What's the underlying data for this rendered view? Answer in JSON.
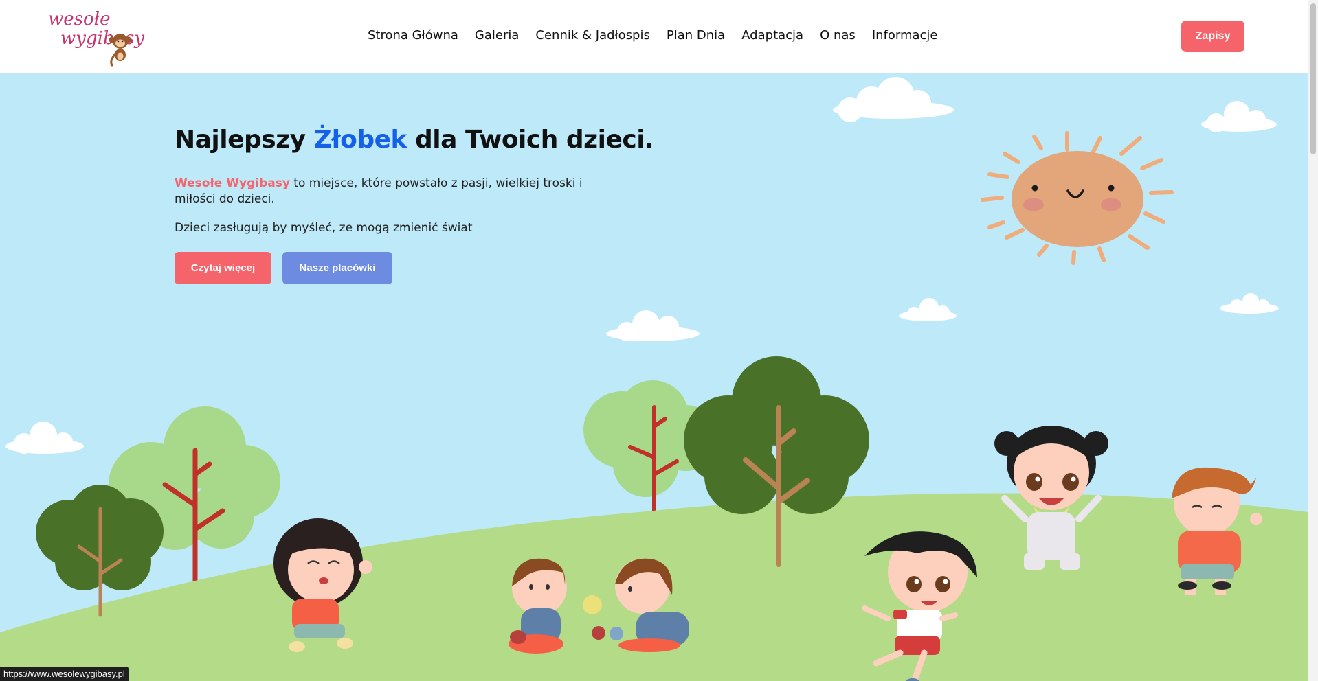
{
  "header": {
    "logo": {
      "line1": "wesołe",
      "line2": "wygibasy"
    },
    "nav": [
      {
        "label": "Strona Główna"
      },
      {
        "label": "Galeria"
      },
      {
        "label": "Cennik & Jadłospis"
      },
      {
        "label": "Plan Dnia"
      },
      {
        "label": "Adaptacja"
      },
      {
        "label": "O nas"
      },
      {
        "label": "Informacje"
      }
    ],
    "cta_label": "Zapisy"
  },
  "hero": {
    "headline_before": "Najlepszy ",
    "headline_accent": "Żłobek",
    "headline_after": " dla Twoich dzieci.",
    "brand": "Wesołe Wygibasy",
    "description_rest": " to miejsce, które powstało z pasji, wielkiej troski i miłości do dzieci.",
    "description2": "Dzieci zasługują by myśleć, ze mogą zmienić świat",
    "button_more": "Czytaj więcej",
    "button_places": "Nasze placówki"
  },
  "status_url": "https://www.wesolewygibasy.pl",
  "colors": {
    "accent": "#f6646b",
    "secondary_button": "#6e8be2",
    "headline_accent": "#1560e8",
    "sky": "#bde9f9",
    "grass": "#b3db88"
  }
}
